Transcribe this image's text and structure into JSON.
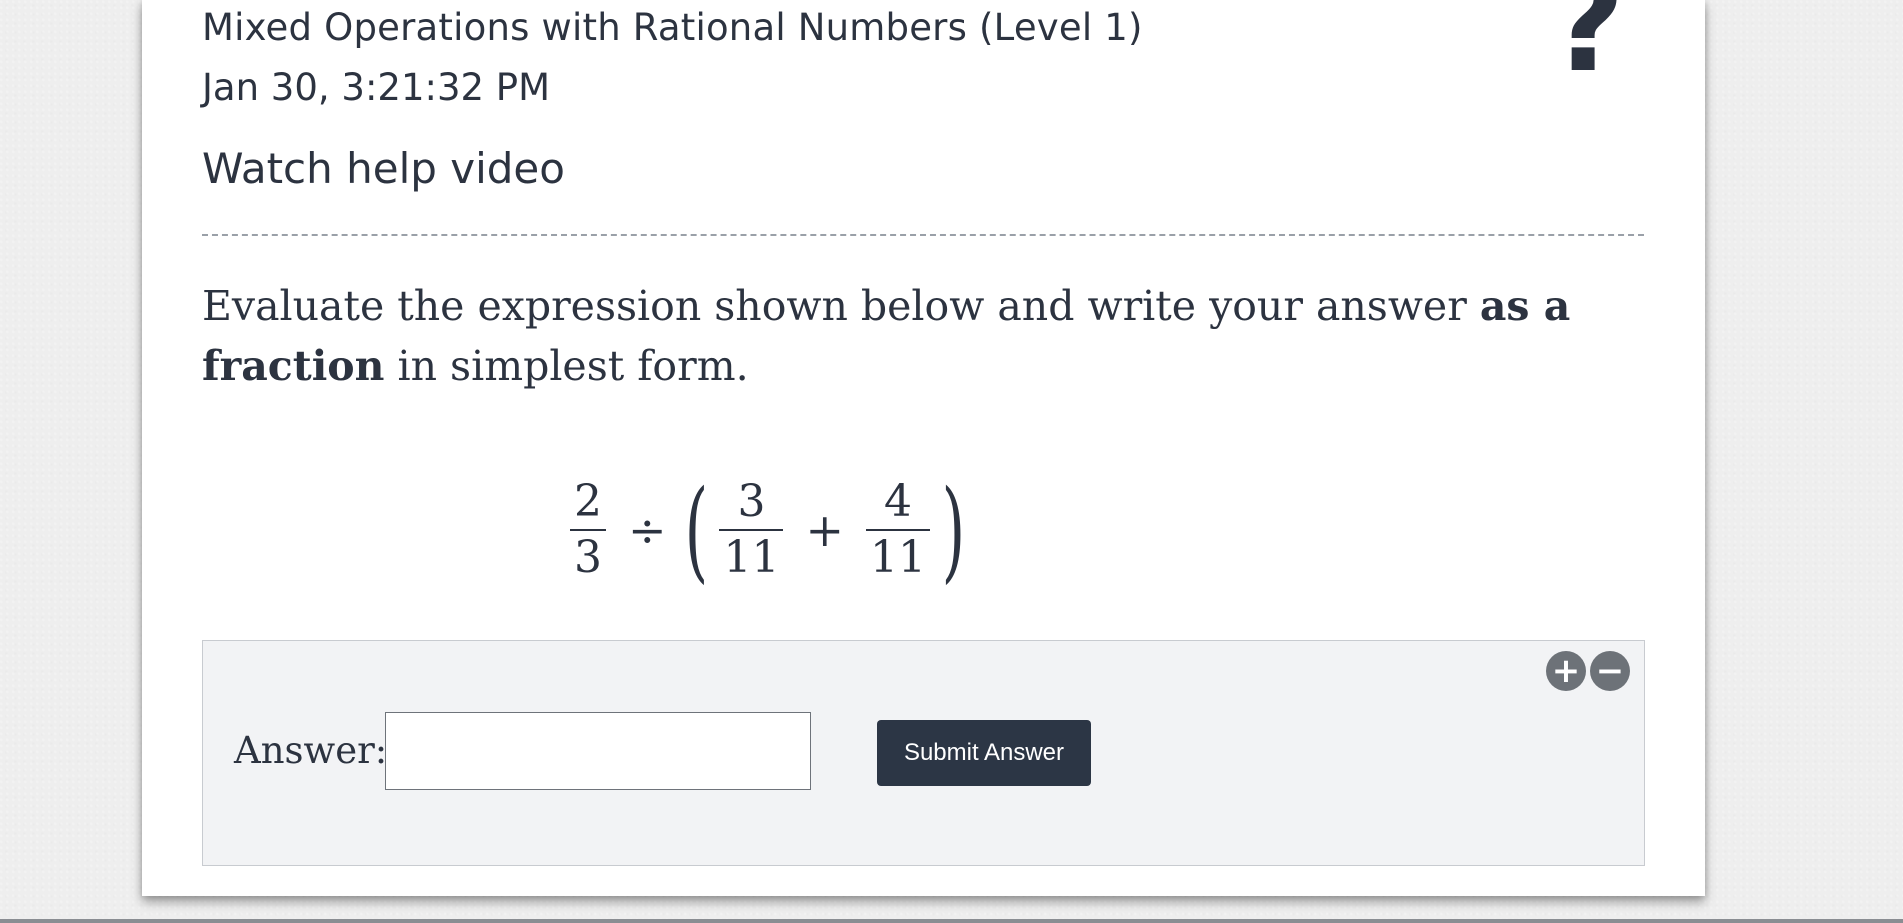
{
  "assignment": {
    "title": "Mixed Operations with Rational Numbers (Level 1)",
    "timestamp": "Jan 30, 3:21:32 PM",
    "help_video_label": "Watch help video",
    "help_icon_glyph": "?"
  },
  "problem": {
    "instruction_before": "Evaluate the expression shown below and write your answer ",
    "instruction_bold": "as a fraction",
    "instruction_after": " in simplest form.",
    "expression": {
      "frac1": {
        "num": "2",
        "den": "3"
      },
      "op1": "÷",
      "open_paren": "(",
      "frac2": {
        "num": "3",
        "den": "11"
      },
      "op2": "+",
      "frac3": {
        "num": "4",
        "den": "11"
      },
      "close_paren": ")"
    }
  },
  "answer": {
    "label": "Answer:",
    "value": "",
    "submit_label": "Submit Answer",
    "zoom_in_glyph": "+",
    "zoom_out_glyph": "−"
  },
  "colors": {
    "text": "#2c3340",
    "button_bg": "#2c3645",
    "answer_panel_bg": "#f2f3f5",
    "zoom_button_bg": "#6d7278"
  }
}
